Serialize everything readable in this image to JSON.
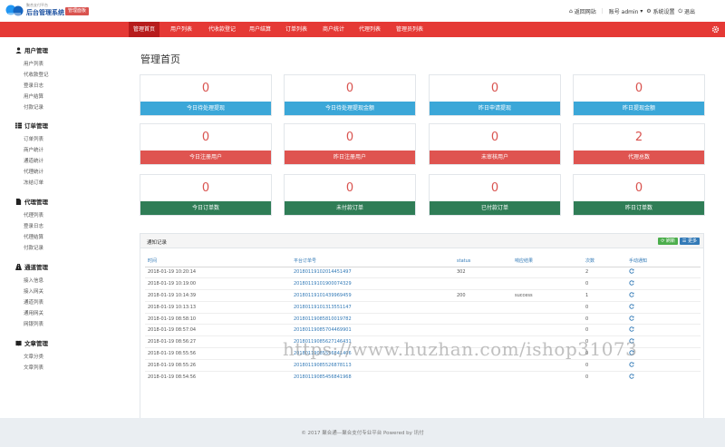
{
  "header": {
    "brand_sub": "聚合支付平台",
    "brand_title": "后台管理系统",
    "brand_badge": "管理面板",
    "links": {
      "back_site": "返回网站",
      "account": "账号 admin",
      "settings": "系统设置",
      "logout": "退出"
    }
  },
  "nav": {
    "items": [
      "管理首页",
      "用户列表",
      "代收款登记",
      "用户结算",
      "订单列表",
      "商户统计",
      "代理列表",
      "管理员列表"
    ],
    "active_index": 0
  },
  "sidebar": {
    "groups": [
      {
        "title": "用户管理",
        "icon": "user-icon",
        "items": [
          "用户列表",
          "代收款登记",
          "登录日志",
          "用户结算",
          "付款记录"
        ]
      },
      {
        "title": "订单管理",
        "icon": "list-icon",
        "items": [
          "订单列表",
          "商户统计",
          "通道统计",
          "代理统计",
          "冻结订单"
        ]
      },
      {
        "title": "代理管理",
        "icon": "file-icon",
        "items": [
          "代理列表",
          "登录日志",
          "代理结算",
          "付款记录"
        ]
      },
      {
        "title": "通道管理",
        "icon": "road-icon",
        "items": [
          "接入信息",
          "接入网关",
          "通道列表",
          "通用网关",
          "网银列表"
        ]
      },
      {
        "title": "文章管理",
        "icon": "book-icon",
        "items": [
          "文章分类",
          "文章列表"
        ]
      }
    ]
  },
  "main": {
    "title": "管理首页",
    "stats": [
      {
        "value": "0",
        "label": "今日待处理提现",
        "color": "#3ba7d8"
      },
      {
        "value": "0",
        "label": "今日待处理提现金额",
        "color": "#3ba7d8"
      },
      {
        "value": "0",
        "label": "昨日申请提现",
        "color": "#3ba7d8"
      },
      {
        "value": "0",
        "label": "昨日提现金额",
        "color": "#3ba7d8"
      },
      {
        "value": "0",
        "label": "今日注册用户",
        "color": "#df5450"
      },
      {
        "value": "0",
        "label": "昨日注册用户",
        "color": "#df5450"
      },
      {
        "value": "0",
        "label": "未审核用户",
        "color": "#df5450"
      },
      {
        "value": "2",
        "label": "代理总数",
        "color": "#df5450"
      },
      {
        "value": "0",
        "label": "今日订单数",
        "color": "#2f7d56"
      },
      {
        "value": "0",
        "label": "未付款订单",
        "color": "#2f7d56"
      },
      {
        "value": "0",
        "label": "已付款订单",
        "color": "#2f7d56"
      },
      {
        "value": "0",
        "label": "昨日订单数",
        "color": "#2f7d56"
      }
    ],
    "records": {
      "title": "通知记录",
      "refresh_label": "刷新",
      "more_label": "更多",
      "columns": [
        "时间",
        "平台订单号",
        "status",
        "响应结果",
        "次数",
        "手动通知"
      ],
      "rows": [
        [
          "2018-01-19 10:20:14",
          "20180119102014451497",
          "302",
          "",
          "2"
        ],
        [
          "2018-01-19 10:19:00",
          "20180119101900074329",
          "",
          "",
          "0"
        ],
        [
          "2018-01-19 10:14:39",
          "20180119101439969459",
          "200",
          "success",
          "1"
        ],
        [
          "2018-01-19 10:13:13",
          "20180119101313551147",
          "",
          "",
          "0"
        ],
        [
          "2018-01-19 08:58:10",
          "20180119085810019782",
          "",
          "",
          "0"
        ],
        [
          "2018-01-19 08:57:04",
          "20180119085704469901",
          "",
          "",
          "0"
        ],
        [
          "2018-01-19 08:56:27",
          "20180119085627146431",
          "",
          "",
          "0"
        ],
        [
          "2018-01-19 08:55:56",
          "20180119085556841406",
          "",
          "",
          "0"
        ],
        [
          "2018-01-19 08:55:26",
          "20180119085526878113",
          "",
          "",
          "0"
        ],
        [
          "2018-01-19 08:54:56",
          "20180119085456841968",
          "",
          "",
          "0"
        ]
      ]
    }
  },
  "footer": {
    "text": "© 2017  聚合通—聚合支付专业平台 Powered by 讯付"
  },
  "watermark": "https://www.huzhan.com/ishop31073"
}
